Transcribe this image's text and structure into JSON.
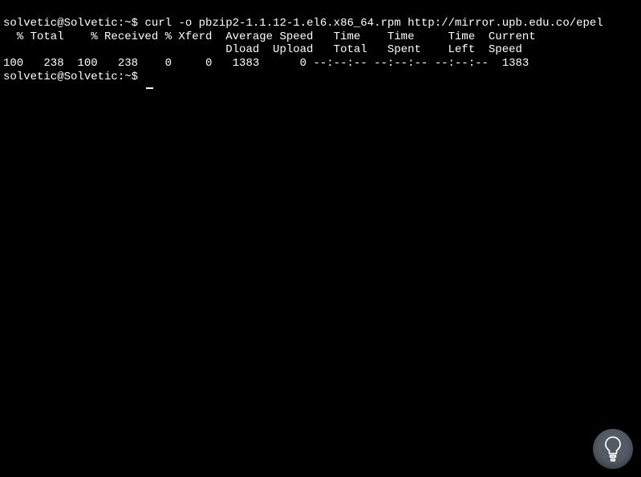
{
  "terminal": {
    "line1": {
      "prompt": "solvetic@Solvetic:~$ ",
      "command": "curl -o pbzip2-1.1.12-1.el6.x86_64.rpm http://mirror.upb.edu.co/epel"
    },
    "header1": "  % Total    % Received % Xferd  Average Speed   Time    Time     Time  Current",
    "header2": "                                 Dload  Upload   Total   Spent    Left  Speed",
    "progress": "100   238  100   238    0     0   1383      0 --:--:-- --:--:-- --:--:--  1383",
    "line2": {
      "prompt": "solvetic@Solvetic:~$ "
    }
  },
  "chart_data": {
    "type": "table",
    "title": "curl transfer progress",
    "columns": [
      "% Total",
      "Total",
      "% Received",
      "Received",
      "% Xferd",
      "Xferd",
      "Average Dload",
      "Average Upload",
      "Time Total",
      "Time Spent",
      "Time Left",
      "Current Speed"
    ],
    "rows": [
      [
        100,
        238,
        100,
        238,
        0,
        0,
        1383,
        0,
        "--:--:--",
        "--:--:--",
        "--:--:--",
        1383
      ]
    ]
  }
}
